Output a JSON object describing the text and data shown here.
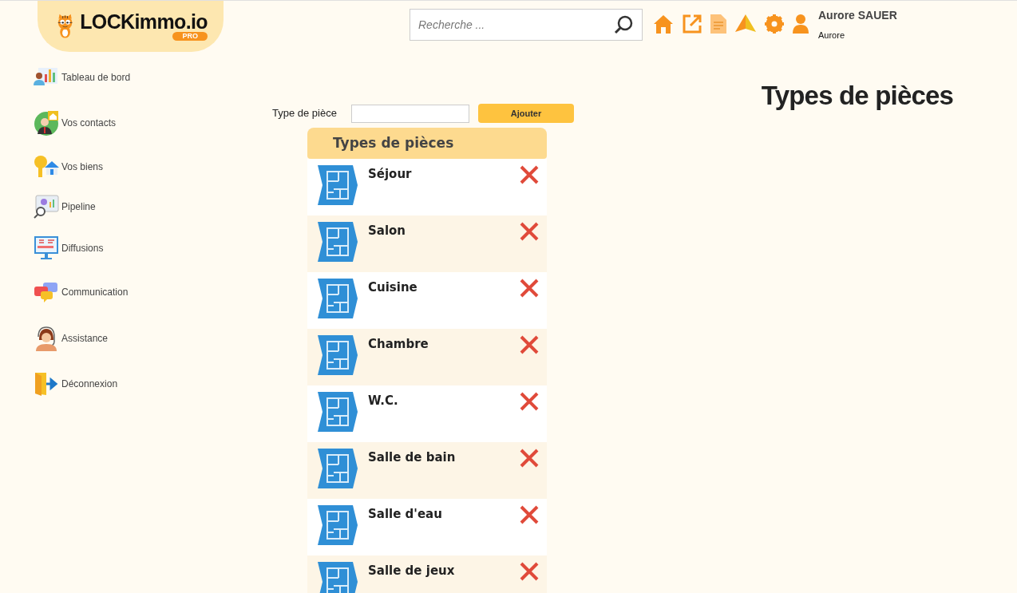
{
  "logo": {
    "brand": "LOCKimmo.io",
    "badge": "PRO"
  },
  "search": {
    "placeholder": "Recherche ..."
  },
  "user": {
    "name": "Aurore SAUER",
    "first_name": "Aurore"
  },
  "sidebar": {
    "items": [
      {
        "label": "Tableau de bord",
        "kind": "dashboard"
      },
      {
        "label": "Vos contacts",
        "kind": "contacts"
      },
      {
        "label": "Vos biens",
        "kind": "properties"
      },
      {
        "label": "Pipeline",
        "kind": "pipeline"
      },
      {
        "label": "Diffusions",
        "kind": "diffusion"
      },
      {
        "label": "Communication",
        "kind": "communication"
      },
      {
        "label": "Assistance",
        "kind": "assistance"
      },
      {
        "label": "Déconnexion",
        "kind": "logout"
      }
    ]
  },
  "page_title": "Types de pièces",
  "form": {
    "label": "Type de pièce",
    "button": "Ajouter"
  },
  "list": {
    "header": "Types de pièces",
    "rows": [
      {
        "name": "Séjour"
      },
      {
        "name": "Salon"
      },
      {
        "name": "Cuisine"
      },
      {
        "name": "Chambre"
      },
      {
        "name": "W.C."
      },
      {
        "name": "Salle de bain"
      },
      {
        "name": "Salle d'eau"
      },
      {
        "name": "Salle de jeux"
      }
    ]
  }
}
